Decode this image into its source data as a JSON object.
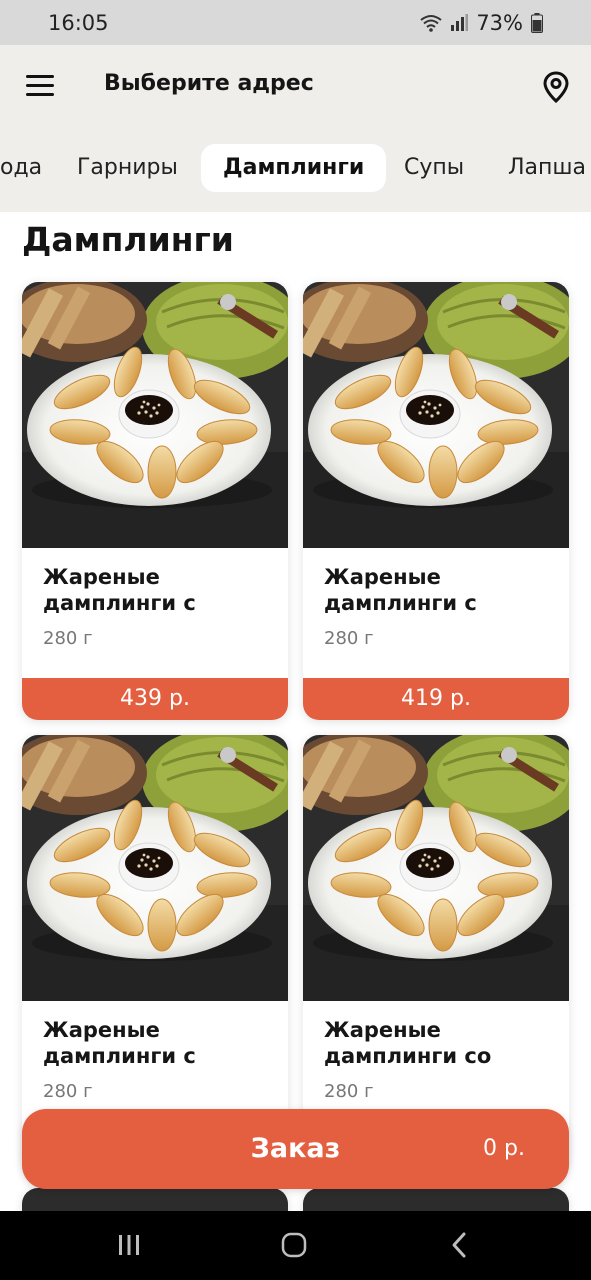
{
  "status": {
    "time": "16:05",
    "battery": "73%"
  },
  "header": {
    "title": "Выберите адрес"
  },
  "tabs": [
    {
      "label": "ода"
    },
    {
      "label": "Гарниры"
    },
    {
      "label": "Дамплинги"
    },
    {
      "label": "Супы"
    },
    {
      "label": "Лапша"
    }
  ],
  "section": {
    "title": "Дамплинги"
  },
  "products": [
    {
      "name": "Жареные дамплинги с",
      "weight": "280 г",
      "price": "439 р."
    },
    {
      "name": "Жареные дамплинги с",
      "weight": "280 г",
      "price": "419 р."
    },
    {
      "name": "Жареные дамплинги с",
      "weight": "280 г",
      "price": ""
    },
    {
      "name": "Жареные дамплинги со",
      "weight": "280 г",
      "price": ""
    }
  ],
  "order": {
    "label": "Заказ",
    "total": "0 р."
  },
  "colors": {
    "accent": "#e45e40",
    "header_bg": "#efeeeb",
    "status_bg": "#d9d9d9"
  },
  "icons": {
    "menu": "hamburger-icon",
    "location": "map-pin-icon",
    "wifi": "wifi-icon",
    "signal": "signal-icon",
    "battery": "battery-icon",
    "nav_recents": "recents-icon",
    "nav_home": "home-icon",
    "nav_back": "back-icon"
  }
}
